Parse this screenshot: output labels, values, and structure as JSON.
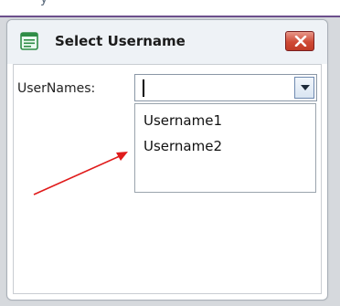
{
  "window": {
    "title": "Select Username",
    "field_label": "UserNames:",
    "combo_value": "",
    "list_items": [
      "Username1",
      "Username2"
    ]
  },
  "icons": [
    "app-form-icon",
    "close-icon",
    "dropdown-arrow-icon"
  ],
  "colors": {
    "frame_bg": "#d6d9dd",
    "titlebar_bg": "#eef2f6",
    "close_button": "#cf4a35",
    "annotation_arrow": "#e01b1b",
    "top_strip_border": "#6c4f8c"
  }
}
